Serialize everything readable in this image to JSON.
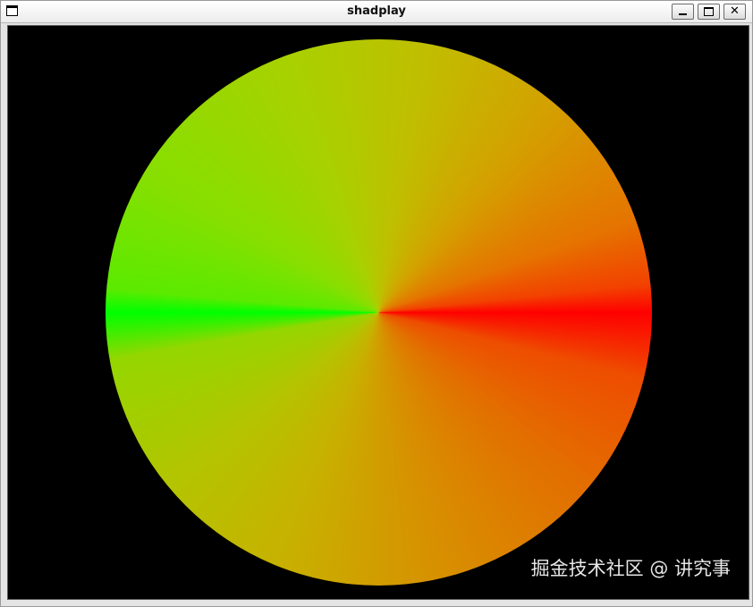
{
  "window": {
    "title": "shadplay",
    "menu_icon": "window-menu-icon",
    "controls": {
      "minimize_icon": "minimize-icon",
      "maximize_icon": "maximize-icon",
      "close_icon": "close-icon",
      "close_glyph": "✕"
    }
  },
  "viewport": {
    "background_color": "#000000",
    "shape": "circle",
    "gradient": {
      "type": "angular",
      "start_color": "#ff0000",
      "end_color": "#00ff00"
    }
  },
  "watermark": {
    "text": "掘金技术社区 @ 讲究事"
  }
}
